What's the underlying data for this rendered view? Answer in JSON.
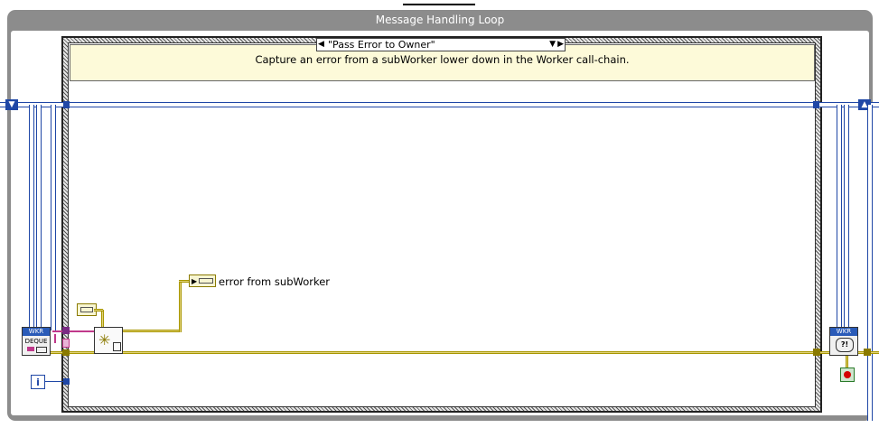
{
  "loop": {
    "title": "Message Handling Loop"
  },
  "case_structure": {
    "selector_value": "\"Pass Error to Owner\"",
    "comment": "Capture an error from a subWorker lower down in the Worker call-chain."
  },
  "nodes": {
    "dequeue_vi": {
      "header": "WKR",
      "label": "DEQUE"
    },
    "handle_vi": {
      "header": "WKR",
      "glyph": "?!"
    },
    "iteration_terminal": {
      "label": "i"
    },
    "output_label": {
      "text": "error from subWorker"
    }
  },
  "colors": {
    "loop_frame": "#8c8c8c",
    "comment_bg": "#fdfad9",
    "class_wire": "#1f47a6",
    "error_wire": "#a89600",
    "message_wire": "#c0398b",
    "stop_terminal": "#d40000"
  }
}
